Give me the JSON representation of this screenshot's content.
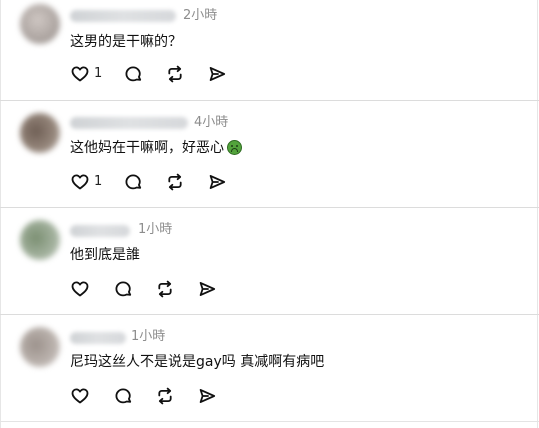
{
  "comments": [
    {
      "time": "2小時",
      "text": "这男的是干嘛的？",
      "emoji": "",
      "like_count": "1",
      "avatar_color": "#b9b2ae"
    },
    {
      "time": "4小時",
      "text": "这他妈在干嘛啊，好恶心",
      "emoji": "nauseated-face-emoji",
      "like_count": "1",
      "avatar_color": "#8f7f72"
    },
    {
      "time": "1小時",
      "text": "他到底是誰",
      "emoji": "",
      "like_count": "",
      "avatar_color": "#889a84"
    },
    {
      "time": "1小時",
      "text": "尼玛这丝人不是说是gay吗 真减啊有病吧",
      "emoji": "",
      "like_count": "",
      "avatar_color": "#a8a09b"
    }
  ],
  "icons": {
    "like": "heart-icon",
    "reply": "comment-bubble-icon",
    "repost": "repost-icon",
    "share": "send-icon"
  },
  "colors": {
    "text": "#111111",
    "meta": "#8d8d8d",
    "divider": "#dcdcdc"
  }
}
